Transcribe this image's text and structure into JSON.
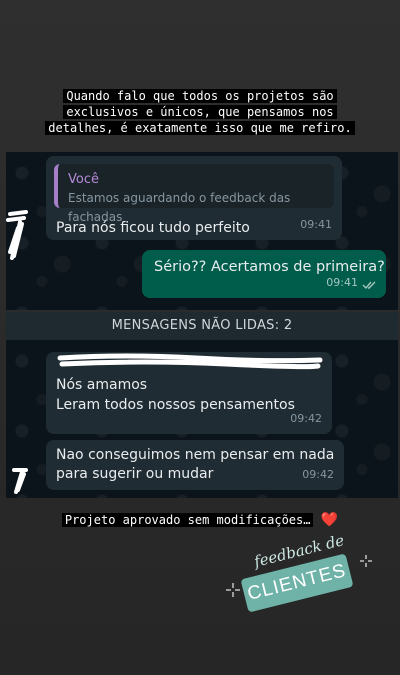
{
  "caption_top": [
    "Quando falo que todos os projetos são",
    "exclusivos e únicos, que pensamos nos",
    "detalhes, é exatamente isso que me refiro."
  ],
  "chat1": {
    "reply": {
      "quote_author": "Você",
      "quote_text": "Estamos aguardando o feedback das fachadas",
      "text": "Para nós ficou tudo perfeito",
      "time": "09:41"
    },
    "outgoing": {
      "text": "Sério?? Acertamos de primeira?",
      "time": "09:41"
    }
  },
  "unread_banner": "MENSAGENS NÃO LIDAS: 2",
  "chat2": {
    "msg1": {
      "line1": "Nós amamos",
      "line2": "Leram todos nossos pensamentos",
      "time": "09:42"
    },
    "msg2": {
      "line1": "Nao conseguimos nem pensar em nada",
      "line2": "para sugerir ou mudar",
      "time": "09:42"
    }
  },
  "caption_bottom": "Projeto aprovado sem modificações…",
  "heart_emoji": "❤️",
  "sticker": {
    "line1": "feedback de",
    "line2": "CLIENTES"
  },
  "colors": {
    "outgoing_bubble": "#005c4b",
    "incoming_bubble": "#202c33",
    "quote_bar": "#a77fc9",
    "sticker_teal": "#6fb3a8"
  }
}
